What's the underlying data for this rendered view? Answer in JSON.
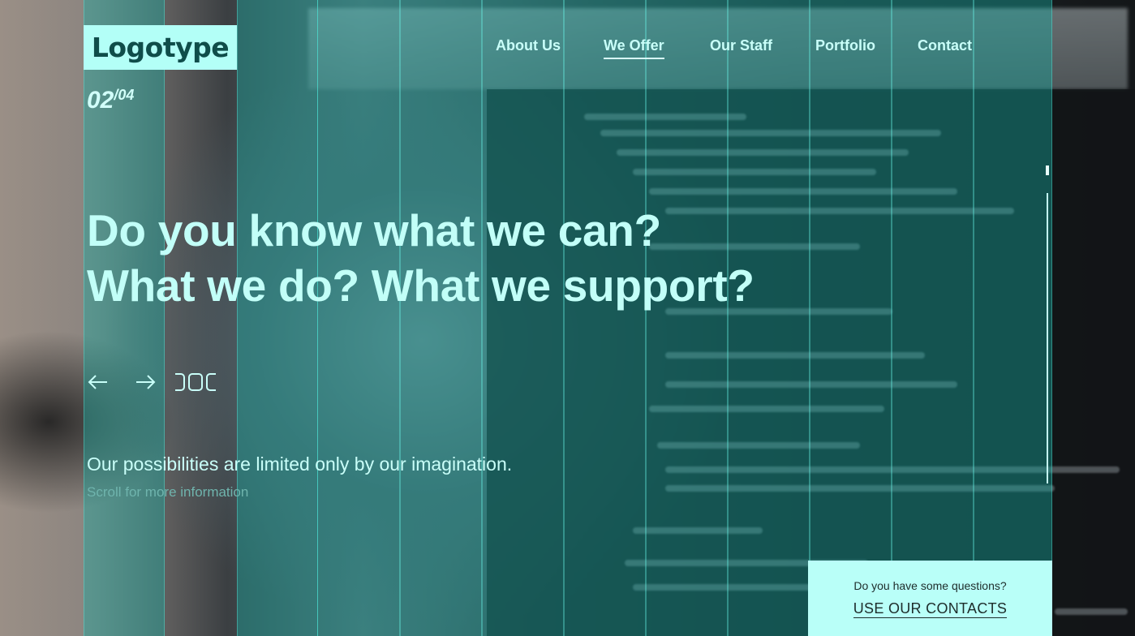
{
  "logo": {
    "text": "Logotype"
  },
  "nav": {
    "items": [
      {
        "label": "About Us",
        "active": false
      },
      {
        "label": "We Offer",
        "active": true
      },
      {
        "label": "Our Staff",
        "active": false
      },
      {
        "label": "Portfolio",
        "active": false
      },
      {
        "label": "Contact",
        "active": false
      }
    ]
  },
  "slider": {
    "current": "02",
    "total": "/04"
  },
  "hero": {
    "line1": "Do you know what we can?",
    "line2": "What we do? What we support?",
    "tagline": "Our possibilities are limited only by our imagination.",
    "scroll_hint": "Scroll for more information"
  },
  "contact": {
    "question": "Do you have some questions?",
    "cta": "USE OUR CONTACTS"
  },
  "icons": {
    "prev": "arrow-left-icon",
    "next": "arrow-right-icon"
  },
  "colors": {
    "accent": "#b3fff7",
    "overlay": "#16aaa0",
    "text_dark": "#1e2c2b"
  }
}
